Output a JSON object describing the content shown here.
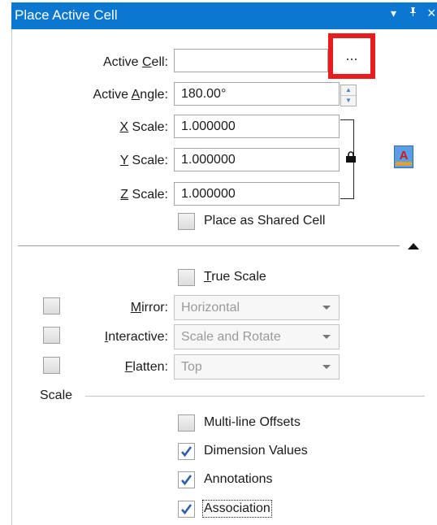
{
  "window": {
    "title": "Place Active Cell",
    "menu_glyph": "▾",
    "pin_glyph": "ᴾ",
    "close_glyph": "×"
  },
  "fields": {
    "active_cell": {
      "label": "Active Cell:",
      "value": ""
    },
    "browse_label": "...",
    "active_angle": {
      "label": "Active Angle:",
      "value": "180.00°"
    },
    "x_scale": {
      "label": "X Scale:",
      "value": "1.000000"
    },
    "y_scale": {
      "label": "Y Scale:",
      "value": "1.000000"
    },
    "z_scale": {
      "label": "Z Scale:",
      "value": "1.000000"
    },
    "text_style_icon_letter": "A"
  },
  "options": {
    "place_as_shared_cell": {
      "label": "Place as Shared Cell",
      "checked": false
    },
    "true_scale": {
      "label": "True Scale",
      "checked": false
    }
  },
  "dropdowns": {
    "mirror": {
      "label": "Mirror:",
      "value": "Horizontal",
      "enabled": false
    },
    "interactive": {
      "label": "Interactive:",
      "value": "Scale and Rotate",
      "enabled": false
    },
    "flatten": {
      "label": "Flatten:",
      "value": "Top",
      "enabled": false
    }
  },
  "scale_section": {
    "title": "Scale",
    "multi_line_offsets": {
      "label": "Multi-line Offsets",
      "checked": false
    },
    "dimension_values": {
      "label": "Dimension Values",
      "checked": true
    },
    "annotations": {
      "label": "Annotations",
      "checked": true
    },
    "association": {
      "label": "Association",
      "checked": true
    }
  },
  "colors": {
    "title_bar": "#0b77d1",
    "highlight_box": "#e81c1c",
    "check_mark": "#2b5fa8"
  }
}
